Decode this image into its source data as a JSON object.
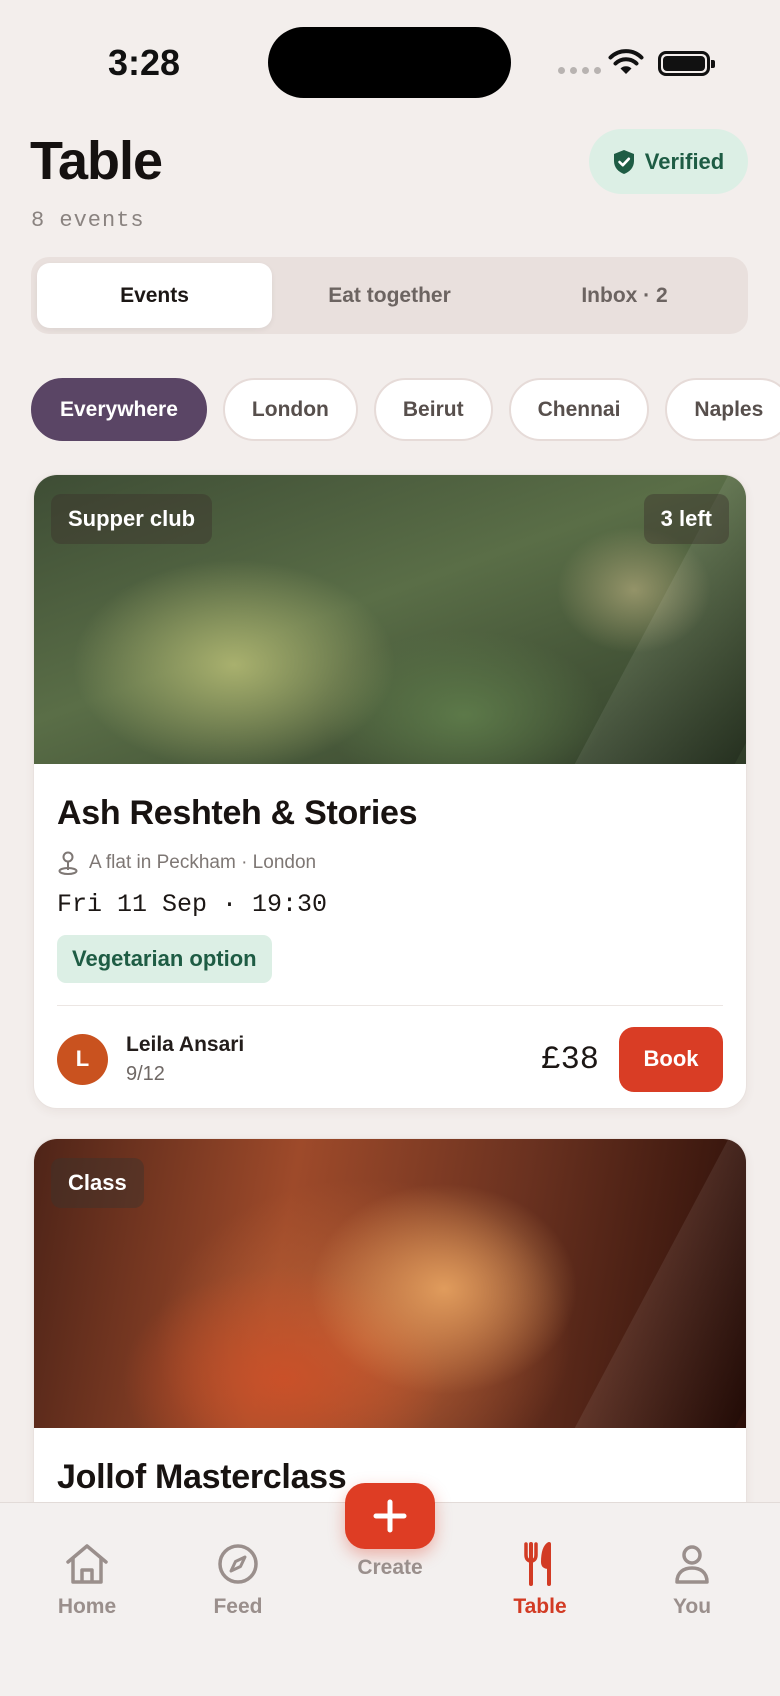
{
  "status_bar": {
    "time": "3:28"
  },
  "header": {
    "title": "Table",
    "subtitle": "8 events",
    "verified_label": "Verified"
  },
  "segments": [
    {
      "label": "Events",
      "active": true
    },
    {
      "label": "Eat together",
      "active": false
    },
    {
      "label": "Inbox · 2",
      "active": false
    }
  ],
  "filters": [
    {
      "label": "Everywhere",
      "active": true
    },
    {
      "label": "London",
      "active": false
    },
    {
      "label": "Beirut",
      "active": false
    },
    {
      "label": "Chennai",
      "active": false
    },
    {
      "label": "Naples",
      "active": false
    }
  ],
  "events": [
    {
      "category": "Supper club",
      "availability": "3 left",
      "title": "Ash Reshteh & Stories",
      "location": "A flat in Peckham · London",
      "datetime": "Fri 11 Sep · 19:30",
      "diet": "Vegetarian option",
      "host_initial": "L",
      "host_name": "Leila Ansari",
      "spots": "9/12",
      "price": "£38",
      "book_label": "Book"
    },
    {
      "category": "Class",
      "title": "Jollof Masterclass"
    }
  ],
  "tab_bar": {
    "home": "Home",
    "feed": "Feed",
    "create": "Create",
    "table": "Table",
    "you": "You"
  },
  "colors": {
    "accent": "#d93d25",
    "filter_active": "#5a4565",
    "verified_bg": "#dcefe5",
    "verified_text": "#1e5c44",
    "background": "#f3eeec"
  }
}
